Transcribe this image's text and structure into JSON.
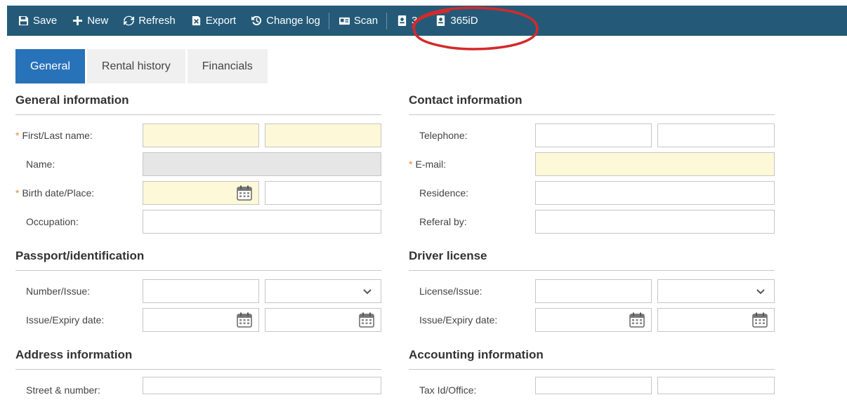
{
  "toolbar": {
    "save": "Save",
    "new": "New",
    "refresh": "Refresh",
    "export": "Export",
    "change_log": "Change log",
    "scan": "Scan",
    "btn_365_partial": "3",
    "btn_365id": "365iD"
  },
  "tabs": [
    "General",
    "Rental history",
    "Financials"
  ],
  "sections": {
    "general_info": "General information",
    "contact_info": "Contact information",
    "passport": "Passport/identification",
    "driver_license": "Driver license",
    "address_info": "Address information",
    "accounting_info": "Accounting information"
  },
  "labels": {
    "first_last_name": "First/Last name:",
    "name": "Name:",
    "birth_date_place": "Birth date/Place:",
    "occupation": "Occupation:",
    "telephone": "Telephone:",
    "email": "E-mail:",
    "residence": "Residence:",
    "referal_by": "Referal by:",
    "number_issue": "Number/Issue:",
    "issue_expiry_date": "Issue/Expiry date:",
    "license_issue": "License/Issue:",
    "license_issue_expiry_date": "Issue/Expiry date:",
    "street_number": "Street & number:",
    "tax_id_office": "Tax Id/Office:"
  },
  "required_mark": "*",
  "colors": {
    "toolbar_bg": "#245a78",
    "tab_active": "#2872b9",
    "required_field_bg": "#fdf8d8",
    "disabled_field_bg": "#e6e6e6",
    "required_asterisk": "#e8883a",
    "annotation_circle": "#d42a2a"
  }
}
